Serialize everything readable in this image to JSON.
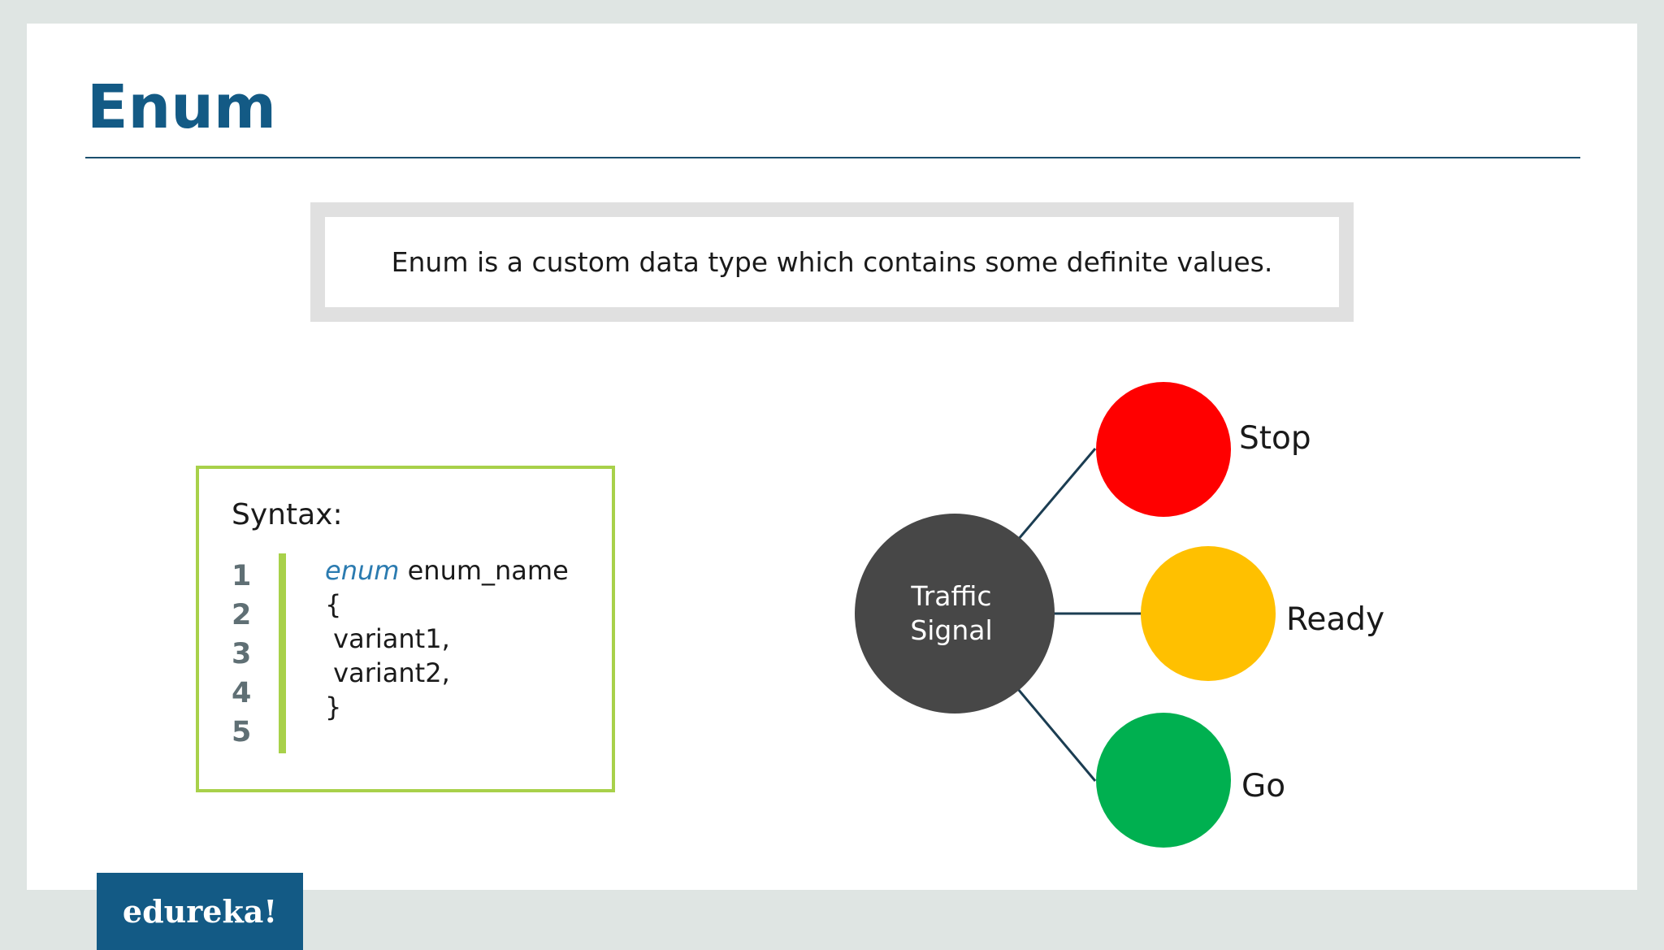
{
  "slide": {
    "title": "Enum",
    "definition": "Enum is a custom data type which contains some definite values."
  },
  "syntax": {
    "label": "Syntax:",
    "line_numbers": [
      "1",
      "2",
      "3",
      "4",
      "5"
    ],
    "keyword": "enum",
    "lines": [
      " enum_name",
      "{",
      " variant1,",
      " variant2,",
      "}"
    ]
  },
  "diagram": {
    "center_label_line1": "Traffic",
    "center_label_line2": "Signal",
    "nodes": [
      {
        "label": "Stop",
        "color": "#ff0000"
      },
      {
        "label": "Ready",
        "color": "#ffc000"
      },
      {
        "label": "Go",
        "color": "#00b050"
      }
    ],
    "center_color": "#474747",
    "edge_color": "#1b3d52"
  },
  "footer": {
    "logo_text": "edureka!",
    "logo_color": "#135a85"
  }
}
